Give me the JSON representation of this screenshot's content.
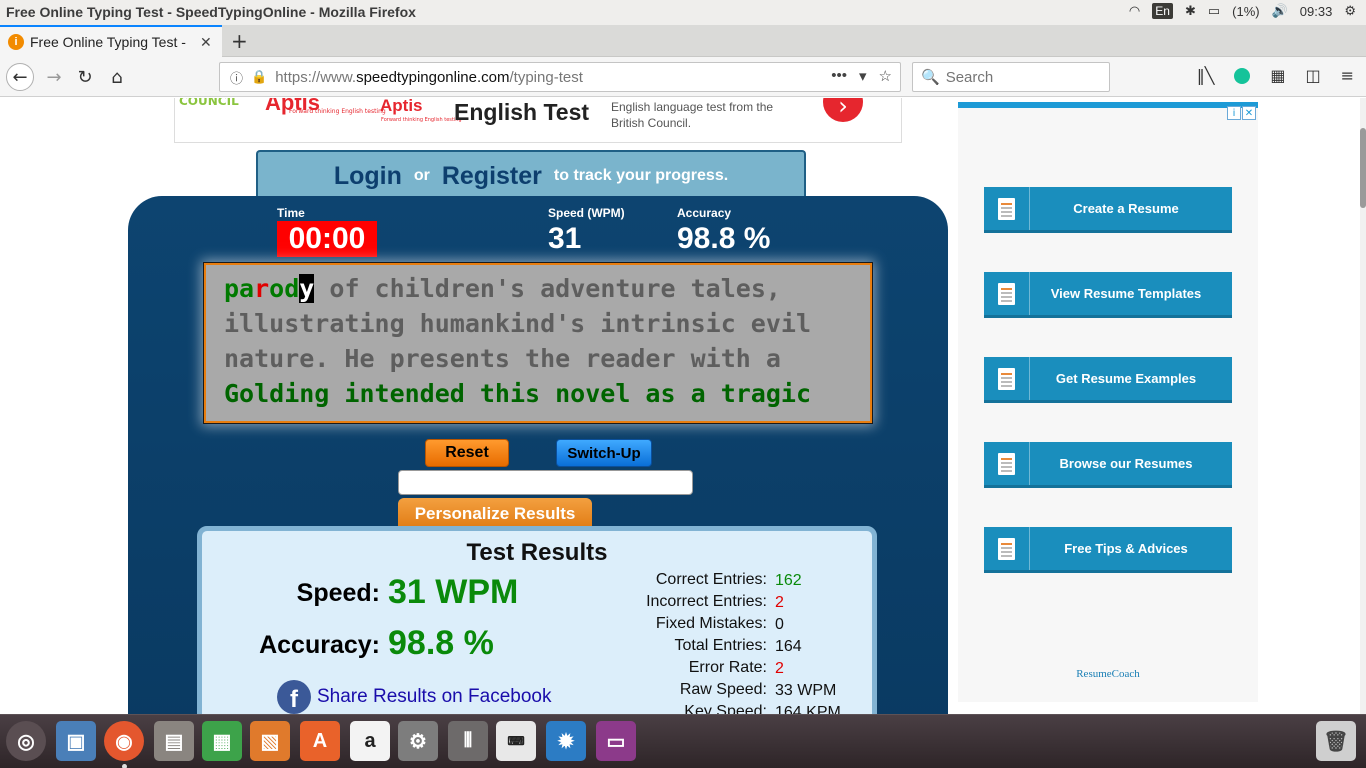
{
  "system": {
    "window_title": "Free Online Typing Test - SpeedTypingOnline - Mozilla Firefox",
    "keyboard_layout": "En",
    "battery": "(1%)",
    "clock": "09:33"
  },
  "browser": {
    "tab_title": "Free Online Typing Test - SpeedTypingOnline",
    "url_prefix": "https://www.",
    "url_domain": "speedtypingonline.com",
    "url_path": "/typing-test",
    "search_placeholder": "Search"
  },
  "top_ad": {
    "council": "COUNCIL",
    "brand1": "Aptis",
    "brand1_sub": "Forward thinking English testing",
    "brand2": "Aptis",
    "brand2_sub": "Forward thinking English testing",
    "heading": "English Test",
    "description": "English language test from the British Council."
  },
  "login_bar": {
    "login": "Login",
    "or": "or",
    "register": "Register",
    "suffix": "to track your progress."
  },
  "stats": {
    "time_label": "Time",
    "time_value": "00:00",
    "speed_label": "Speed (WPM)",
    "speed_value": "31",
    "accuracy_label": "Accuracy",
    "accuracy_value": "98.8 %"
  },
  "typing_text": {
    "l1_ok1": "pa",
    "l1_bad": "r",
    "l1_ok2": "od",
    "l1_cursor": "y",
    "l1_rest": " of children's adventure tales,",
    "l2": "illustrating humankind's intrinsic evil",
    "l3": "nature. He presents the reader with a",
    "l4": "Golding intended this novel as a tragic"
  },
  "controls": {
    "reset": "Reset",
    "switch_up": "Switch-Up",
    "personalize": "Personalize Results"
  },
  "results": {
    "title": "Test Results",
    "speed_label": "Speed:",
    "speed_value": "31 WPM",
    "accuracy_label": "Accuracy:",
    "accuracy_value": "98.8 %",
    "share": "Share Results on Facebook",
    "rows": [
      {
        "label": "Correct Entries:",
        "value": "162"
      },
      {
        "label": "Incorrect Entries:",
        "value": "2"
      },
      {
        "label": "Fixed Mistakes:",
        "value": "0"
      },
      {
        "label": "Total Entries:",
        "value": "164"
      },
      {
        "label": "Error Rate:",
        "value": "2"
      },
      {
        "label": "Raw Speed:",
        "value": "33 WPM"
      },
      {
        "label": "Key Speed:",
        "value": "164 KPM"
      }
    ]
  },
  "side_ad": {
    "buttons": [
      "Create a Resume",
      "View Resume Templates",
      "Get Resume Examples",
      "Browse our Resumes",
      "Free Tips & Advices"
    ],
    "brand": "ResumeCoach"
  },
  "dock": {
    "items": [
      "dash-icon",
      "image-viewer-icon",
      "firefox-icon",
      "files-icon",
      "spreadsheet-icon",
      "presentation-icon",
      "software-center-icon",
      "amazon-icon",
      "settings-icon",
      "mixer-icon",
      "keyboard-icon",
      "screenshot-icon",
      "window-icon",
      "trash-icon"
    ]
  }
}
